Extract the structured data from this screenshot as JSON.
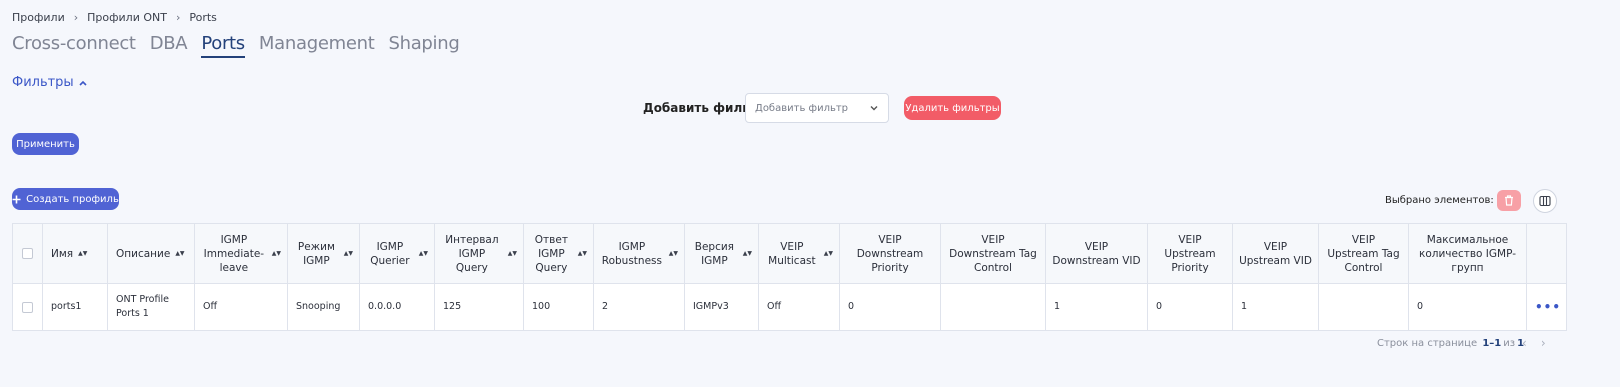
{
  "breadcrumb": [
    "Профили",
    "Профили ONT",
    "Ports"
  ],
  "tabs": [
    {
      "label": "Cross-connect",
      "active": false
    },
    {
      "label": "DBA",
      "active": false
    },
    {
      "label": "Ports",
      "active": true
    },
    {
      "label": "Management",
      "active": false
    },
    {
      "label": "Shaping",
      "active": false
    }
  ],
  "filters": {
    "toggle_label": "Фильтры",
    "add_filter_label": "Добавить фильтр",
    "select_placeholder": "Добавить фильтр",
    "clear_label": "Удалить фильтры",
    "apply_label": "Применить"
  },
  "toolbar": {
    "create_label": "Создать профиль",
    "selected_label": "Выбрано элементов: 0"
  },
  "table": {
    "columns": [
      "Имя",
      "Описание",
      "IGMP Immediate-leave",
      "Режим IGMP",
      "IGMP Querier",
      "Интервал IGMP Query",
      "Ответ IGMP Query",
      "IGMP Robustness",
      "Версия IGMP",
      "VEIP Multicast",
      "VEIP Downstream Priority",
      "VEIP Downstream Tag Control",
      "VEIP Downstream VID",
      "VEIP Upstream Priority",
      "VEIP Upstream VID",
      "VEIP Upstream Tag Control",
      "Максимальное количество IGMP-групп"
    ],
    "rows": [
      [
        "ports1",
        "ONT Profile Ports 1",
        "Off",
        "Snooping",
        "0.0.0.0",
        "125",
        "100",
        "2",
        "IGMPv3",
        "Off",
        "0",
        "",
        "1",
        "0",
        "1",
        "",
        "0"
      ]
    ]
  },
  "pagination": {
    "rows_per_page_label": "Строк на странице",
    "range": "1–1",
    "of_label": "из",
    "total": "1"
  },
  "colors": {
    "accent": "#5063d4",
    "danger": "#f25c67",
    "active_tab": "#23417a"
  }
}
